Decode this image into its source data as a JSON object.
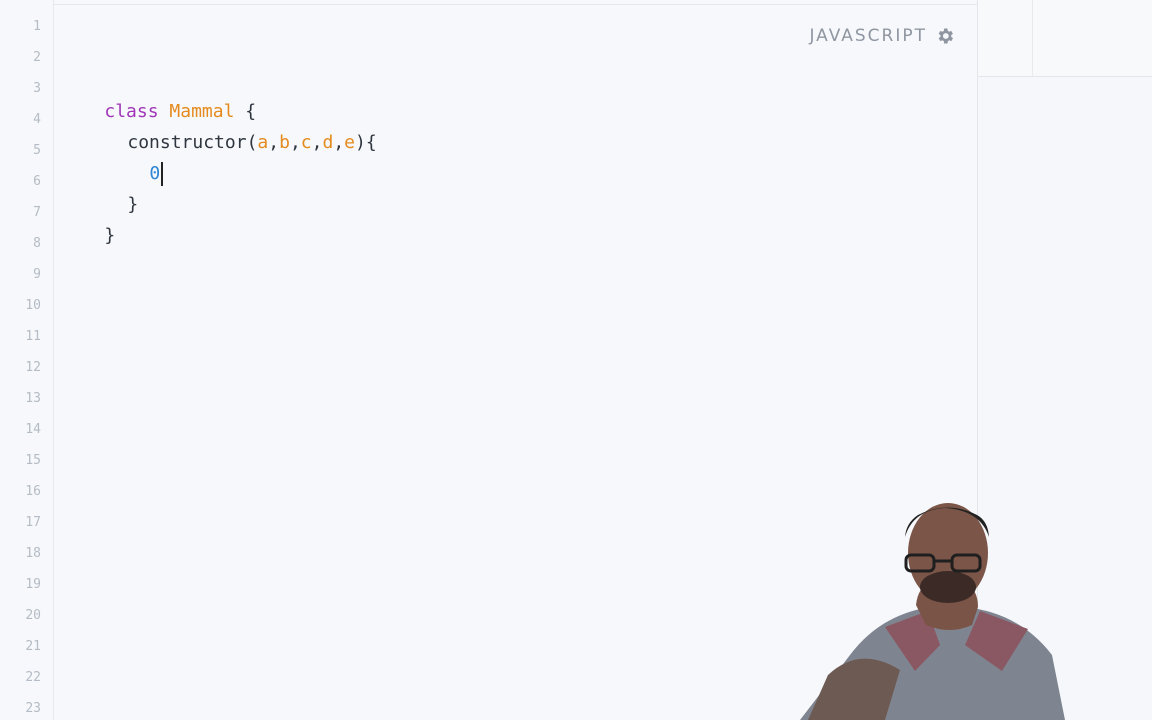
{
  "editor": {
    "language": "JAVASCRIPT",
    "line_numbers": [
      "1",
      "2",
      "3",
      "4",
      "5",
      "6",
      "7",
      "8",
      "9",
      "10",
      "11",
      "12",
      "13",
      "14",
      "15",
      "16",
      "17",
      "18",
      "19",
      "20",
      "21",
      "22",
      "23"
    ],
    "code": {
      "line3": {
        "keyword": "class",
        "class_name": "Mammal",
        "rest": " {"
      },
      "line4": {
        "ctor": "constructor(",
        "params": [
          "a",
          "b",
          "c",
          "d",
          "e"
        ],
        "end": "){"
      },
      "line5": {
        "text": "0"
      },
      "line6": {
        "text": "}"
      },
      "line7": {
        "text": "}"
      }
    }
  },
  "colors": {
    "keyword": "#a035b8",
    "class_name": "#e58a1d",
    "param": "#e58a1d",
    "number": "#2f86d6",
    "line_number": "#b5bcc5"
  },
  "icons": {
    "settings": "gear-icon"
  }
}
